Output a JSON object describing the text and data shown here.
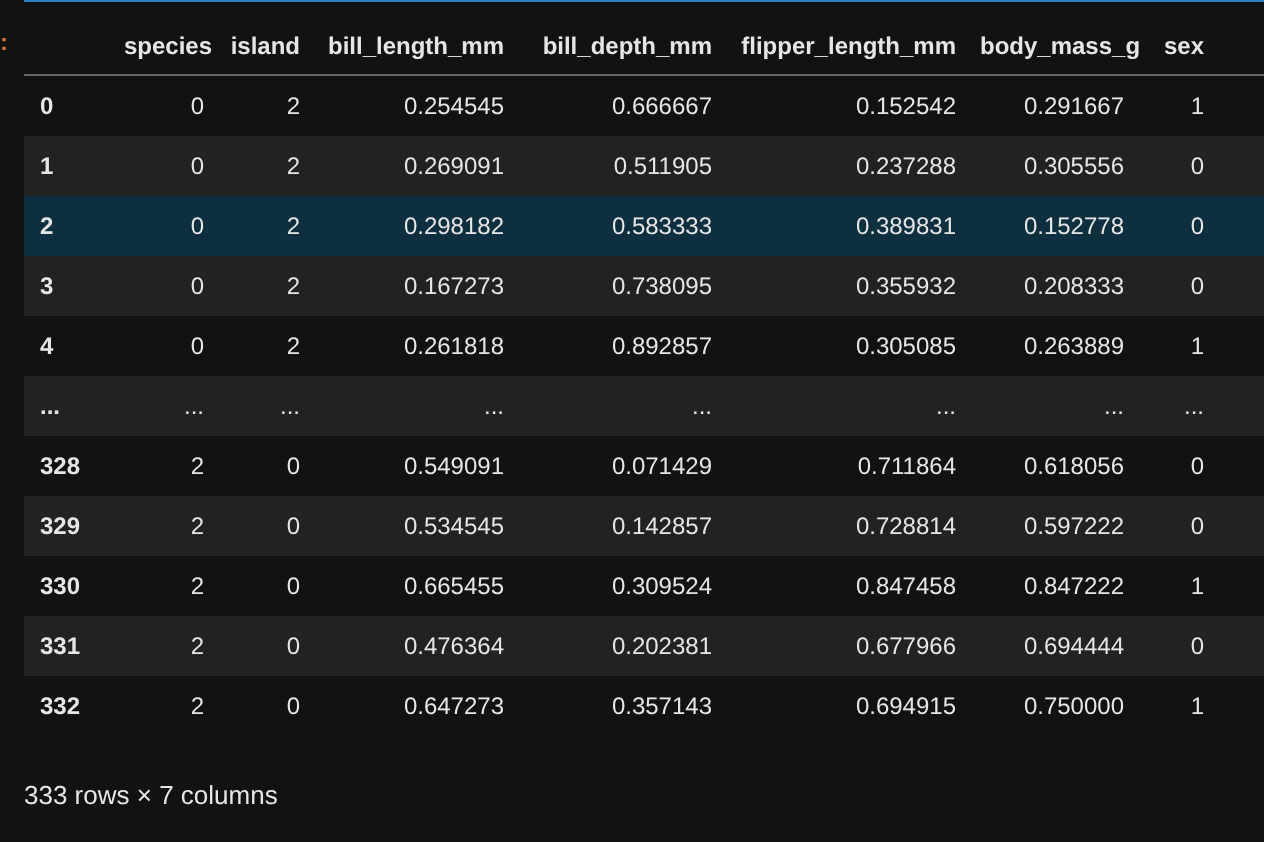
{
  "prompt_marker": ":",
  "table": {
    "columns": [
      "species",
      "island",
      "bill_length_mm",
      "bill_depth_mm",
      "flipper_length_mm",
      "body_mass_g",
      "sex"
    ],
    "rows": [
      {
        "index": "0",
        "cells": [
          "0",
          "2",
          "0.254545",
          "0.666667",
          "0.152542",
          "0.291667",
          "1"
        ],
        "selected": false
      },
      {
        "index": "1",
        "cells": [
          "0",
          "2",
          "0.269091",
          "0.511905",
          "0.237288",
          "0.305556",
          "0"
        ],
        "selected": false
      },
      {
        "index": "2",
        "cells": [
          "0",
          "2",
          "0.298182",
          "0.583333",
          "0.389831",
          "0.152778",
          "0"
        ],
        "selected": true
      },
      {
        "index": "3",
        "cells": [
          "0",
          "2",
          "0.167273",
          "0.738095",
          "0.355932",
          "0.208333",
          "0"
        ],
        "selected": false
      },
      {
        "index": "4",
        "cells": [
          "0",
          "2",
          "0.261818",
          "0.892857",
          "0.305085",
          "0.263889",
          "1"
        ],
        "selected": false
      },
      {
        "index": "...",
        "cells": [
          "...",
          "...",
          "...",
          "...",
          "...",
          "...",
          "..."
        ],
        "selected": false
      },
      {
        "index": "328",
        "cells": [
          "2",
          "0",
          "0.549091",
          "0.071429",
          "0.711864",
          "0.618056",
          "0"
        ],
        "selected": false
      },
      {
        "index": "329",
        "cells": [
          "2",
          "0",
          "0.534545",
          "0.142857",
          "0.728814",
          "0.597222",
          "0"
        ],
        "selected": false
      },
      {
        "index": "330",
        "cells": [
          "2",
          "0",
          "0.665455",
          "0.309524",
          "0.847458",
          "0.847222",
          "1"
        ],
        "selected": false
      },
      {
        "index": "331",
        "cells": [
          "2",
          "0",
          "0.476364",
          "0.202381",
          "0.677966",
          "0.694444",
          "0"
        ],
        "selected": false
      },
      {
        "index": "332",
        "cells": [
          "2",
          "0",
          "0.647273",
          "0.357143",
          "0.694915",
          "0.750000",
          "1"
        ],
        "selected": false
      }
    ]
  },
  "footer": "333 rows × 7 columns"
}
